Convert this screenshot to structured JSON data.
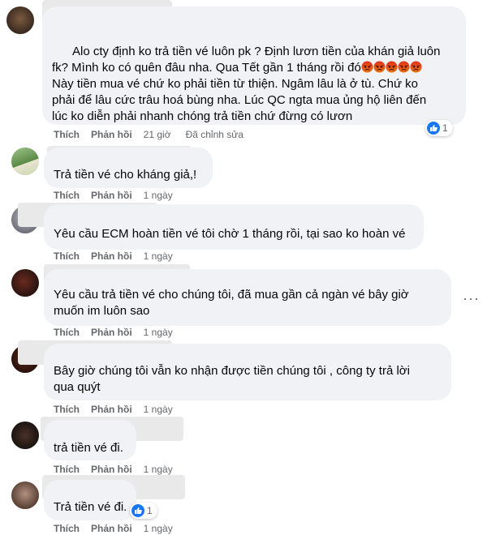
{
  "comments": [
    {
      "text": "Alo cty định ko trả tiền vé luôn pk ? Định lươn tiền của khán giả luôn\nfk? Mình ko có quên đâu nha. Qua Tết gần 1 tháng rồi đó",
      "text2": "Này tiền mua vé chứ ko phải tiền từ thiện. Ngâm lâu là ở tù. Chứ ko\nphải để lâu cức trâu hoá bùng nha. Lúc QC ngta mua ủng hộ liên đến\nlúc ko diễn phải nhanh chóng trả tiền chứ đừng có lươn",
      "emoji_count": 5,
      "like": "Thích",
      "reply": "Phản hồi",
      "time": "21 giờ",
      "edited": "Đã chỉnh sửa",
      "reactions": "1"
    },
    {
      "text": "Trả tiền vé cho kháng giả,!",
      "like": "Thích",
      "reply": "Phản hồi",
      "time": "1 ngày"
    },
    {
      "text": "Yêu cầu ECM hoàn tiền vé tôi chờ 1 tháng rồi, tại sao ko hoàn vé",
      "like": "Thích",
      "reply": "Phản hồi",
      "time": "1 ngày"
    },
    {
      "text": "Yêu cầu trả tiền vé cho chúng tôi, đã mua gần cả ngàn vé bây giờ\nmuốn im luôn sao",
      "like": "Thích",
      "reply": "Phản hồi",
      "time": "1 ngày",
      "more": "···"
    },
    {
      "text": "Bây giờ chúng tôi vẫn ko nhận được tiền chúng tôi , công ty trả lời\nqua quýt",
      "like": "Thích",
      "reply": "Phản hồi",
      "time": "1 ngày"
    },
    {
      "text": "trả tiền vé đi.",
      "like": "Thích",
      "reply": "Phản hồi",
      "time": "1 ngày"
    },
    {
      "text": "Trả tiền vé đi.",
      "like": "Thích",
      "reply": "Phản hồi",
      "time": "1 ngày",
      "reactions": "1"
    }
  ],
  "colors": {
    "accent": "#1877f2",
    "bubble": "#f0f2f5",
    "meta": "#65676b",
    "angry_emoji": "#e9710f"
  },
  "icons": {
    "like": "like-icon",
    "angry": "angry-emoji-icon"
  }
}
